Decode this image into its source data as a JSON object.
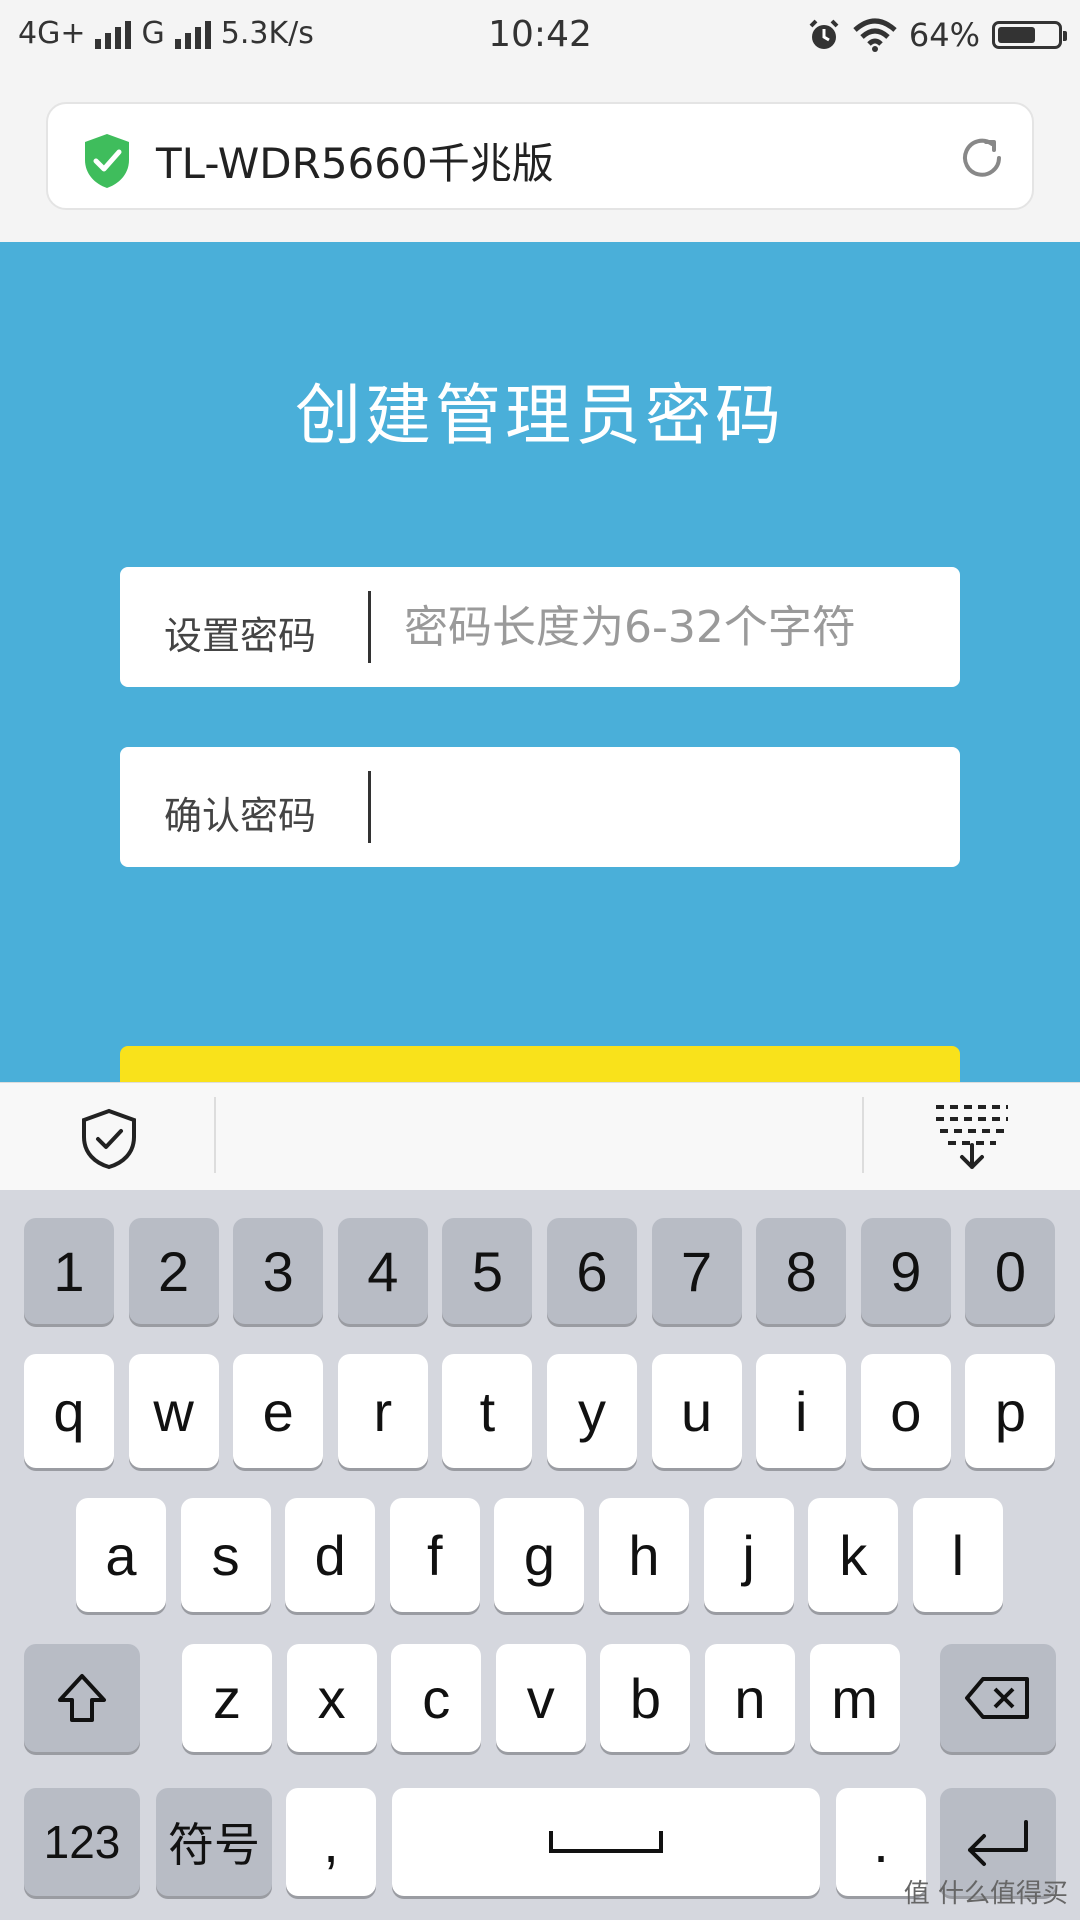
{
  "status_bar": {
    "network_type": "4G+",
    "network_type_2": "G",
    "speed": "5.3K/s",
    "time": "10:42",
    "battery": "64%",
    "battery_level": 0.64
  },
  "browser": {
    "url_title": "TL-WDR5660千兆版"
  },
  "page": {
    "title": "创建管理员密码",
    "set_password": {
      "label": "设置密码",
      "placeholder": "密码长度为6-32个字符"
    },
    "confirm_password": {
      "label": "确认密码",
      "placeholder": ""
    },
    "submit_color": "#f9e21b",
    "background_color": "#4aafd9"
  },
  "keyboard": {
    "row_numbers": [
      "1",
      "2",
      "3",
      "4",
      "5",
      "6",
      "7",
      "8",
      "9",
      "0"
    ],
    "row_1": [
      "q",
      "w",
      "e",
      "r",
      "t",
      "y",
      "u",
      "i",
      "o",
      "p"
    ],
    "row_2": [
      "a",
      "s",
      "d",
      "f",
      "g",
      "h",
      "j",
      "k",
      "l"
    ],
    "row_3": [
      "z",
      "x",
      "c",
      "v",
      "b",
      "n",
      "m"
    ],
    "key_123": "123",
    "key_symbols": "符号",
    "key_comma": ",",
    "key_period": "."
  },
  "watermark": "值 什么值得买"
}
